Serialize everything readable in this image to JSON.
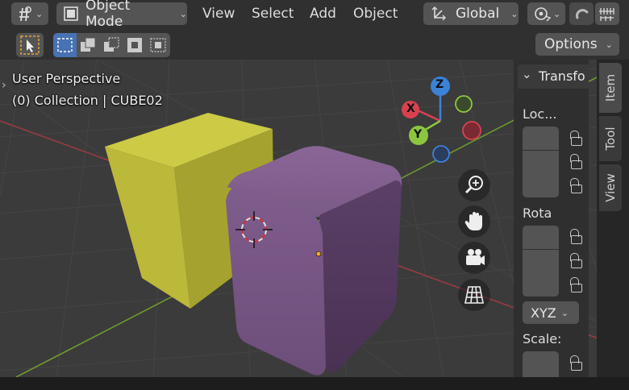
{
  "header": {
    "mode_label": "Object Mode",
    "menus": [
      "View",
      "Select",
      "Add",
      "Object"
    ],
    "orientation_label": "Global"
  },
  "toolbar2": {
    "options_label": "Options"
  },
  "viewport": {
    "perspective_label": "User Perspective",
    "collection_label": "(0) Collection | CUBE02",
    "gizmo": {
      "x": "X",
      "y": "Y",
      "z": "Z"
    },
    "colors": {
      "yellow_cube": "#c9c63b",
      "purple_cube": "#7d5a8a",
      "x_axis": "#d8424f",
      "y_axis": "#8cc63f",
      "z_axis": "#3b82d8"
    }
  },
  "sidebar": {
    "panel_title": "Transfo",
    "location_label": "Loc...",
    "rotation_label": "Rota",
    "rotation_mode": "XYZ",
    "scale_label": "Scale:",
    "tabs": [
      "Item",
      "Tool",
      "View"
    ]
  }
}
